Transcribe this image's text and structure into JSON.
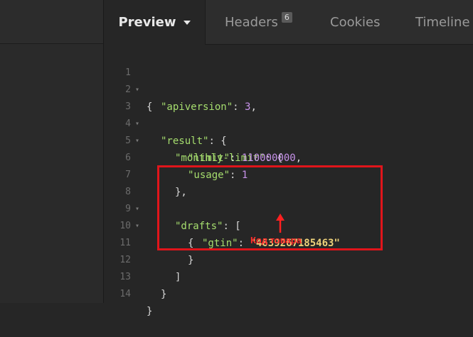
{
  "tabs": {
    "preview": "Preview",
    "headers": "Headers",
    "headers_count": "6",
    "cookies": "Cookies",
    "timeline": "Timeline"
  },
  "code_lines": [
    {
      "n": "1",
      "fold": "▾"
    },
    {
      "n": "2"
    },
    {
      "n": "3",
      "fold": "▾"
    },
    {
      "n": "4",
      "fold": "▾"
    },
    {
      "n": "5"
    },
    {
      "n": "6"
    },
    {
      "n": "7"
    },
    {
      "n": "8",
      "fold": "▾"
    },
    {
      "n": "9",
      "fold": "▾"
    },
    {
      "n": "10"
    },
    {
      "n": "11"
    },
    {
      "n": "12"
    },
    {
      "n": "13"
    },
    {
      "n": "14"
    }
  ],
  "json": {
    "open_brace": "{",
    "close_brace": "}",
    "apiversion_key": "\"apiversion\"",
    "apiversion_val": "3",
    "result_key": "\"result\"",
    "monthly_limit_key": "\"monthly-limit\"",
    "limit_key": "\"limit\"",
    "limit_val": "110000000",
    "usage_key": "\"usage\"",
    "usage_val": "1",
    "drafts_key": "\"drafts\"",
    "gtin_key": "\"gtin\"",
    "gtin_val": "\"4639267185463\""
  },
  "annotation": "Код товара",
  "colors": {
    "key": "#a6de6e",
    "number": "#c792ea",
    "string": "#eed27a",
    "highlight": "#e0151b"
  }
}
